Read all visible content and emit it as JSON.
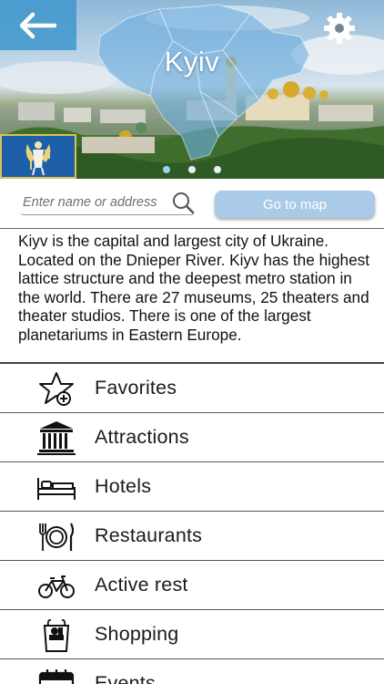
{
  "header": {
    "city_name": "Kyiv",
    "back_icon": "arrow-left-icon",
    "settings_icon": "gear-icon",
    "carousel": {
      "count": 3,
      "active": 1
    }
  },
  "search": {
    "placeholder": "Enter name or address",
    "map_button_label": "Go to map"
  },
  "description": "Kiyv is the capital and largest city of Ukraine. Located on the Dnieper River. Kiyv has the highest lattice structure and the deepest metro station in the world. There are 27 museums, 25 theaters and theater studios. There is one of the largest planetariums in Eastern Europe.",
  "menu": [
    {
      "label": "Favorites",
      "icon": "star-plus-icon"
    },
    {
      "label": "Attractions",
      "icon": "museum-icon"
    },
    {
      "label": "Hotels",
      "icon": "bed-icon"
    },
    {
      "label": "Restaurants",
      "icon": "plate-cutlery-icon"
    },
    {
      "label": "Active rest",
      "icon": "bicycle-icon"
    },
    {
      "label": "Shopping",
      "icon": "shopping-bag-icon"
    },
    {
      "label": "Events",
      "icon": "calendar-icon"
    }
  ],
  "colors": {
    "accent": "#4096cd",
    "map_button": "#a9cbe8",
    "coat_of_arms": "#1d5fa8"
  }
}
